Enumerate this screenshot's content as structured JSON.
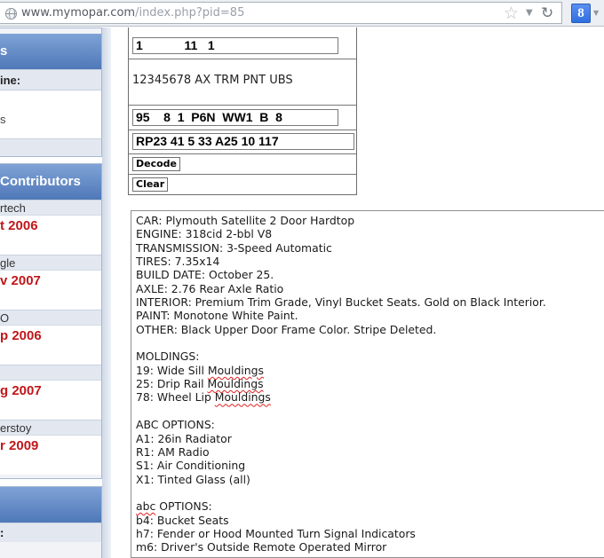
{
  "browser": {
    "url_host": "www.mymopar.com",
    "url_path": "/index.php?pid=85",
    "search_engine_letter": "8"
  },
  "sidebar": {
    "box1": {
      "header": "s",
      "row1": "ine:",
      "row2": "s"
    },
    "box2": {
      "header": "Contributors",
      "contributors": [
        {
          "name": "rtech",
          "date": "t 2006"
        },
        {
          "name": "gle",
          "date": "v 2007"
        },
        {
          "name": "O",
          "date": "p 2006"
        },
        {
          "name": "",
          "date": "g 2007"
        },
        {
          "name": "erstoy",
          "date": "r 2009"
        }
      ]
    },
    "box3": {
      "row": ":"
    }
  },
  "form": {
    "field1_value": "1            11   1",
    "description": "12345678 AX TRM PNT UBS",
    "field3_value": "95    8  1  P6N  WW1  B  8",
    "field4_value": "RP23 41 5 33 A25 10 117",
    "decode_label": "Decode",
    "clear_label": "Clear"
  },
  "result": {
    "lines": [
      {
        "text": "CAR: Plymouth Satellite 2 Door Hardtop"
      },
      {
        "text": "ENGINE: 318cid 2-bbl V8"
      },
      {
        "text": "TRANSMISSION: 3-Speed Automatic"
      },
      {
        "text": "TIRES: 7.35x14"
      },
      {
        "text": "BUILD DATE: October 25."
      },
      {
        "text": "AXLE: 2.76 Rear Axle Ratio"
      },
      {
        "text": "INTERIOR: Premium Trim Grade, Vinyl Bucket Seats. Gold on Black Interior."
      },
      {
        "text": "PAINT: Monotone White Paint."
      },
      {
        "text": "OTHER: Black Upper Door Frame Color. Stripe Deleted."
      },
      {
        "text": ""
      },
      {
        "text": "MOLDINGS:"
      },
      {
        "pre": "19: Wide Sill ",
        "mark": "Mouldings",
        "post": ""
      },
      {
        "pre": "25: Drip Rail ",
        "mark": "Mouldings",
        "post": ""
      },
      {
        "pre": "78: Wheel Lip ",
        "mark": "Mouldings",
        "post": ""
      },
      {
        "text": ""
      },
      {
        "text": "ABC OPTIONS:"
      },
      {
        "text": "A1: 26in Radiator"
      },
      {
        "text": "R1: AM Radio"
      },
      {
        "text": "S1: Air Conditioning"
      },
      {
        "text": "X1: Tinted Glass (all)"
      },
      {
        "text": ""
      },
      {
        "pre": "",
        "mark": "abc",
        "post": " OPTIONS:"
      },
      {
        "text": "b4: Bucket Seats"
      },
      {
        "text": "h7: Fender or Hood Mounted Turn Signal Indicators"
      },
      {
        "text": "m6: Driver's Outside Remote Operated Mirror"
      }
    ]
  },
  "colors": {
    "sidebar_header": "#5b82c0",
    "contributor_date": "#c0171a",
    "spellcheck": "#e02020"
  }
}
